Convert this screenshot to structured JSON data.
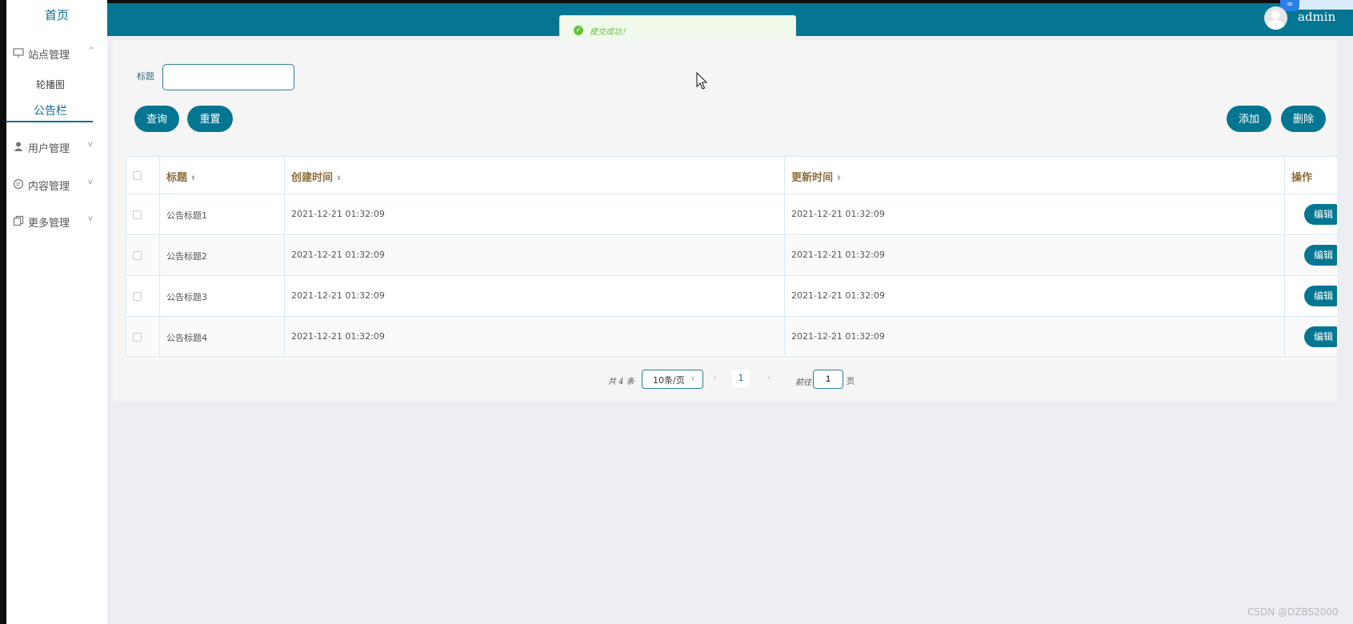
{
  "sidebar": {
    "home": "首页",
    "groups": [
      {
        "label": "站点管理",
        "icon": "monitor-icon",
        "chevron": "^",
        "expanded": true
      },
      {
        "label": "用户管理",
        "icon": "user-icon",
        "chevron": "v"
      },
      {
        "label": "内容管理",
        "icon": "message-icon",
        "chevron": "v"
      },
      {
        "label": "更多管理",
        "icon": "copy-icon",
        "chevron": "v"
      }
    ],
    "subitems": [
      {
        "label": "轮播图"
      },
      {
        "label": "公告栏",
        "active": true
      }
    ]
  },
  "topbar": {
    "username": "admin",
    "badge_icon": "cloud-logo-icon"
  },
  "toast": {
    "message": "提交成功！",
    "type": "success"
  },
  "search": {
    "label": "标题",
    "value": "",
    "query_button": "查询",
    "reset_button": "重置",
    "add_button": "添加",
    "delete_button": "删除"
  },
  "table": {
    "headers": [
      "标题",
      "创建时间",
      "更新时间",
      "操作"
    ],
    "rows": [
      {
        "title": "公告标题1",
        "created": "2021-12-21 01:32:09",
        "updated": "2021-12-21 01:32:09",
        "action": "编辑"
      },
      {
        "title": "公告标题2",
        "created": "2021-12-21 01:32:09",
        "updated": "2021-12-21 01:32:09",
        "action": "编辑"
      },
      {
        "title": "公告标题3",
        "created": "2021-12-21 01:32:09",
        "updated": "2021-12-21 01:32:09",
        "action": "编辑"
      },
      {
        "title": "公告标题4",
        "created": "2021-12-21 01:32:09",
        "updated": "2021-12-21 01:32:09",
        "action": "编辑"
      }
    ]
  },
  "pagination": {
    "total_text": "共 4 条",
    "page_size": "10条/页",
    "current_page": "1",
    "goto_label": "前往",
    "goto_value": "1",
    "page_suffix": "页"
  },
  "watermark": "CSDN @DZBS2000",
  "colors": {
    "primary": "#057692",
    "header_text": "#8b6d3c",
    "success": "#67c23a"
  }
}
